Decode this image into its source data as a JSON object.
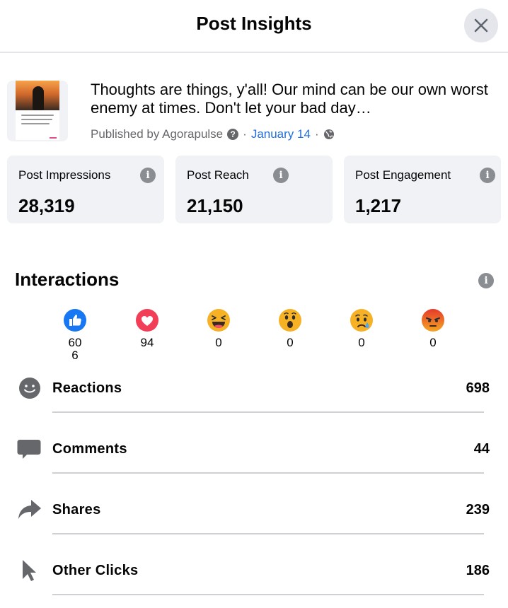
{
  "header": {
    "title": "Post Insights",
    "close_icon": "close-icon"
  },
  "post": {
    "text": "Thoughts are things, y'all! Our mind can be our own worst enemy at times. Don't let your bad day…",
    "published_by": "Published by Agorapulse",
    "date": "January 14",
    "separator": "·",
    "help_icon": "question-icon",
    "audience_icon": "globe-icon"
  },
  "stats": [
    {
      "label": "Post Impressions",
      "value": "28,319"
    },
    {
      "label": "Post Reach",
      "value": "21,150"
    },
    {
      "label": "Post Engagement",
      "value": "1,217"
    }
  ],
  "interactions": {
    "title": "Interactions",
    "reactions": [
      {
        "icon": "like-icon",
        "count": "606"
      },
      {
        "icon": "love-icon",
        "count": "94"
      },
      {
        "icon": "haha-icon",
        "count": "0"
      },
      {
        "icon": "wow-icon",
        "count": "0"
      },
      {
        "icon": "sad-icon",
        "count": "0"
      },
      {
        "icon": "angry-icon",
        "count": "0"
      }
    ],
    "metrics": [
      {
        "icon": "smiley-icon",
        "label": "Reactions",
        "value": "698"
      },
      {
        "icon": "comment-icon",
        "label": "Comments",
        "value": "44"
      },
      {
        "icon": "share-icon",
        "label": "Shares",
        "value": "239"
      },
      {
        "icon": "cursor-icon",
        "label": "Other Clicks",
        "value": "186"
      }
    ]
  },
  "colors": {
    "like": "#1877f2",
    "love": "#f33e58",
    "emoji_yellow": "#f7b125",
    "angry": "#e9710f",
    "link": "#216fdb",
    "card_bg": "#f0f2f5",
    "icon_gray": "#65676b"
  }
}
